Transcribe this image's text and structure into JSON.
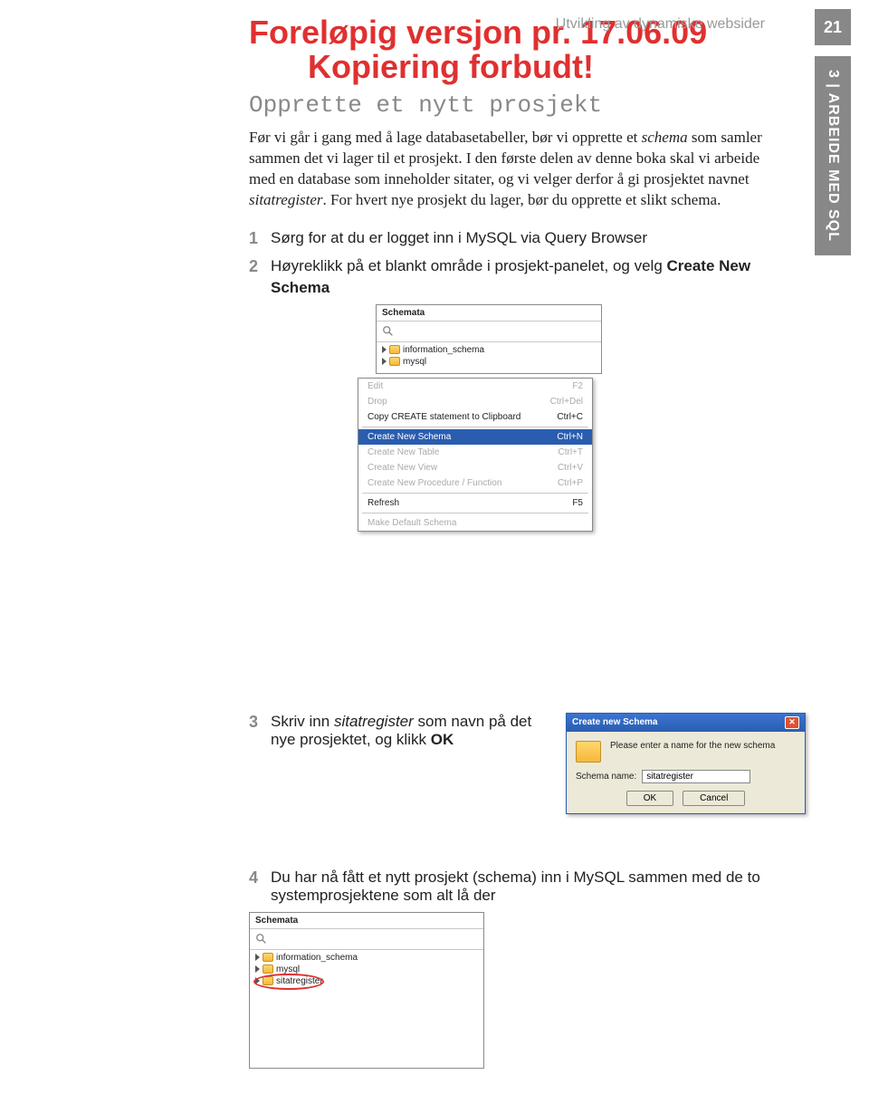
{
  "header": {
    "chapter_title": "Utvikling av dynamiske websider",
    "page_number": "21",
    "side_label": "3 | ARBEIDE MED SQL"
  },
  "watermark": {
    "line1": "Foreløpig versjon pr. 17.06.09",
    "line2": "Kopiering forbudt!"
  },
  "section": {
    "title": "Opprette et nytt prosjekt",
    "body_before_schema": "Før vi går i gang med å lage databasetabeller, bør vi opprette et ",
    "schema_word": "schema",
    "body_mid": " som samler sammen det vi lager til et prosjekt. I den første delen av denne boka skal vi arbeide med en database som inneholder sitater, og vi velger derfor å gi prosjektet navnet ",
    "sitatreg_word": "sitatregister",
    "body_after": ". For hvert nye prosjekt du lager, bør du opprette et slikt schema."
  },
  "steps": {
    "s1": "Sørg for at du er logget inn i MySQL via Query Browser",
    "s2a": "Høyreklikk på et blankt område i prosjekt-panelet, og velg ",
    "s2b": "Create New Schema",
    "s3a": "Skriv inn ",
    "s3b": "sitatregister",
    "s3c": " som navn på det nye prosjektet, og klikk ",
    "s3d": "OK",
    "s4": "Du har nå fått et nytt prosjekt (schema) inn i MySQL sammen med de to systemprosjektene som alt lå der",
    "n1": "1",
    "n2": "2",
    "n3": "3",
    "n4": "4"
  },
  "fig1": {
    "panel_title": "Schemata",
    "item1": "information_schema",
    "item2": "mysql",
    "menu": {
      "edit": "Edit",
      "edit_k": "F2",
      "drop": "Drop",
      "drop_k": "Ctrl+Del",
      "copy": "Copy CREATE statement to Clipboard",
      "copy_k": "Ctrl+C",
      "new_schema": "Create New Schema",
      "new_schema_k": "Ctrl+N",
      "new_table": "Create New Table",
      "new_table_k": "Ctrl+T",
      "new_view": "Create New View",
      "new_view_k": "Ctrl+V",
      "new_proc": "Create New Procedure / Function",
      "new_proc_k": "Ctrl+P",
      "refresh": "Refresh",
      "refresh_k": "F5",
      "make_default": "Make Default Schema"
    }
  },
  "dialog": {
    "title": "Create new Schema",
    "instruction": "Please enter a name for the new schema",
    "label": "Schema name:",
    "value": "sitatregister",
    "ok": "OK",
    "cancel": "Cancel"
  },
  "fig3": {
    "panel_title": "Schemata",
    "item1": "information_schema",
    "item2": "mysql",
    "item3": "sitatregister"
  }
}
